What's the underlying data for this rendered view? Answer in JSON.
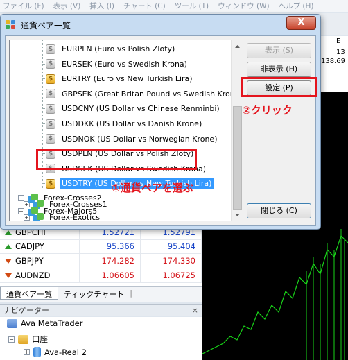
{
  "menu": [
    "ファイル (F)",
    "表示 (V)",
    "挿入 (I)",
    "チャート (C)",
    "ツール (T)",
    "ウィンドウ (W)",
    "ヘルプ (H)"
  ],
  "chart_side": {
    "labels": [
      "E",
      "13",
      "138.69"
    ]
  },
  "market_watch": {
    "rows": [
      {
        "symbol": "GBPCHF",
        "bid": "1.52721",
        "ask": "1.52791",
        "dir": "up",
        "color": "blue"
      },
      {
        "symbol": "CADJPY",
        "bid": "95.366",
        "ask": "95.404",
        "dir": "up",
        "color": "blue"
      },
      {
        "symbol": "GBPJPY",
        "bid": "174.282",
        "ask": "174.330",
        "dir": "down",
        "color": "red"
      },
      {
        "symbol": "AUDNZD",
        "bid": "1.06605",
        "ask": "1.06725",
        "dir": "down",
        "color": "red"
      }
    ],
    "tabs": [
      "通貨ペア一覧",
      "ティックチャート"
    ]
  },
  "navigator": {
    "title": "ナビゲーター",
    "close": "×",
    "items": [
      "Ava MetaTrader",
      "口座",
      "Ava-Real 2"
    ]
  },
  "dialog": {
    "title": "通貨ペア一覧",
    "close_label": "X",
    "symbols": [
      {
        "code": "EURPLN",
        "name": "(Euro vs Polish Zloty)",
        "icon": "grey"
      },
      {
        "code": "EURSEK",
        "name": "(Euro vs Swedish Krona)",
        "icon": "grey"
      },
      {
        "code": "EURTRY",
        "name": "(Euro vs New Turkish Lira)",
        "icon": "gold"
      },
      {
        "code": "GBPSEK",
        "name": "(Great Britan Pound vs Swedish Krona)",
        "icon": "grey"
      },
      {
        "code": "USDCNY",
        "name": "(US Dollar vs Chinese Renminbi)",
        "icon": "grey"
      },
      {
        "code": "USDDKK",
        "name": "(US Dollar vs Danish Krone)",
        "icon": "grey"
      },
      {
        "code": "USDNOK",
        "name": "(US Dollar vs Norwegian Krone)",
        "icon": "grey"
      },
      {
        "code": "USDPLN",
        "name": "(US Dollar vs Polish Zloty)",
        "icon": "grey"
      },
      {
        "code": "USDSEK",
        "name": "(US Dollar vs Swedish Krona)",
        "icon": "grey"
      },
      {
        "code": "USDTRY",
        "name": "(US Dollar vs New Turkish Lira)",
        "icon": "gold",
        "selected": true
      }
    ],
    "groups": [
      "Forex-Crosses1",
      "Forex-Exotics",
      "Forex-Crosses2",
      "Forex-Majors5"
    ],
    "buttons": {
      "show": "表示 (S)",
      "hide": "非表示 (H)",
      "settings": "設定 (P)",
      "close": "閉じる (C)"
    }
  },
  "annotations": {
    "step1": "①通貨ペアを選ぶ",
    "step2": "②クリック"
  },
  "colors": {
    "highlight": "#e4141d",
    "selection": "#3399ff"
  }
}
